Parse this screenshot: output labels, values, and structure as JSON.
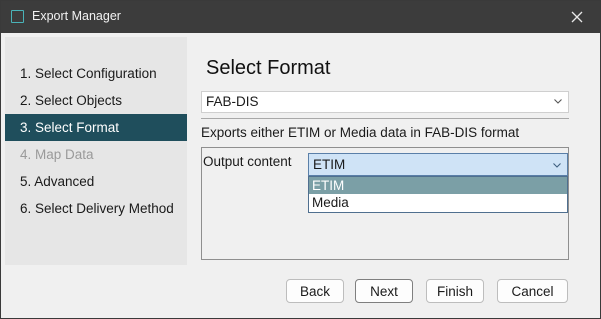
{
  "window": {
    "title": "Export Manager"
  },
  "sidebar": {
    "steps": [
      {
        "label": "1. Select Configuration",
        "state": "normal"
      },
      {
        "label": "2. Select Objects",
        "state": "normal"
      },
      {
        "label": "3. Select Format",
        "state": "active"
      },
      {
        "label": "4. Map Data",
        "state": "disabled"
      },
      {
        "label": "5. Advanced",
        "state": "normal"
      },
      {
        "label": "6. Select Delivery Method",
        "state": "normal"
      }
    ]
  },
  "main": {
    "heading": "Select Format",
    "format_select": {
      "value": "FAB-DIS"
    },
    "description": "Exports either ETIM or Media data in FAB-DIS format",
    "output_content": {
      "label": "Output content",
      "value": "ETIM",
      "options": [
        {
          "label": "ETIM",
          "selected": true
        },
        {
          "label": "Media",
          "selected": false
        }
      ]
    }
  },
  "buttons": {
    "back": "Back",
    "next": "Next",
    "finish": "Finish",
    "cancel": "Cancel"
  },
  "colors": {
    "titlebar": "#3c3c3c",
    "active_step": "#1f4e5c",
    "selected_option": "#7b9fa6",
    "focused_select": "#cfe3f6"
  }
}
